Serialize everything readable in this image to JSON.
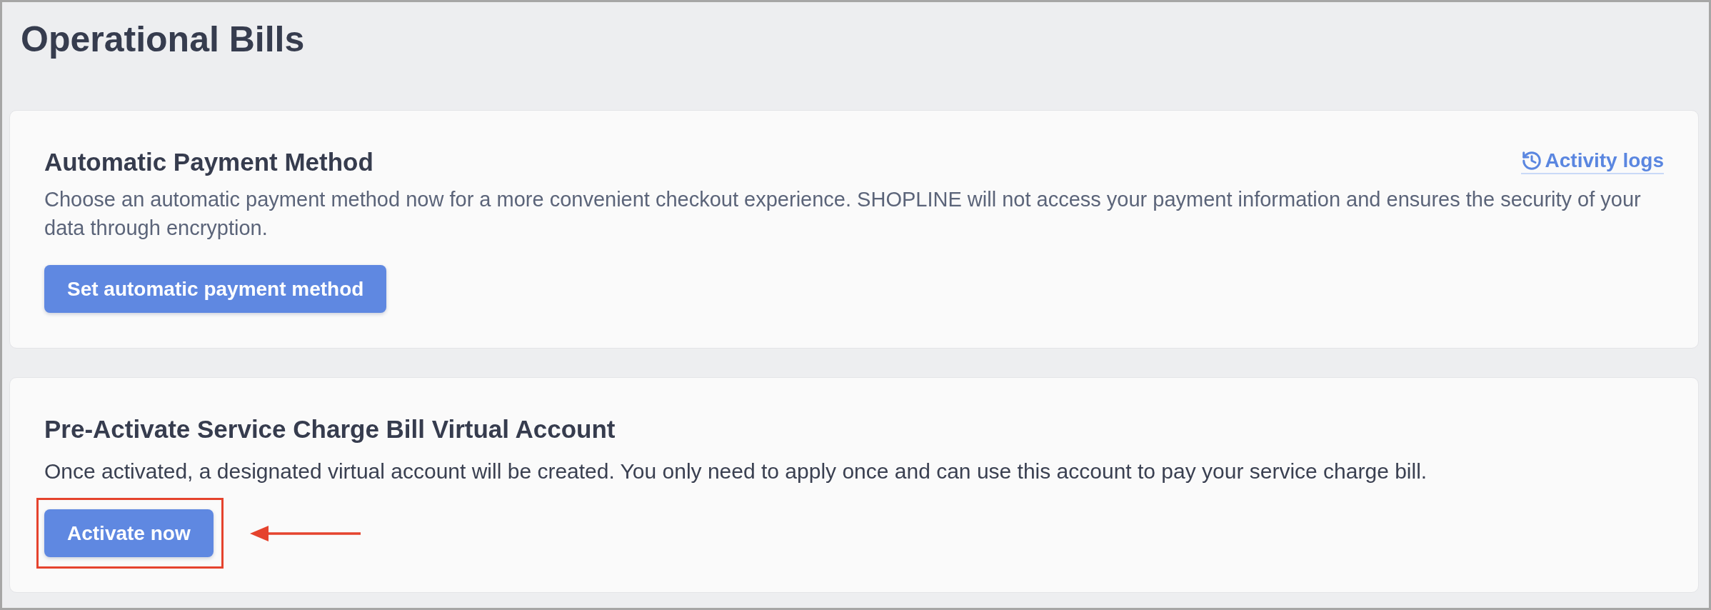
{
  "page": {
    "title": "Operational Bills"
  },
  "cards": [
    {
      "kind": "settings",
      "title": "Automatic Payment Method",
      "link": {
        "label": "Activity logs"
      },
      "description": "Choose an automatic payment method now for a more convenient checkout experience. SHOPLINE will not access your payment information and ensures the security of your data through encryption.",
      "button": {
        "label": "Set automatic payment method"
      }
    },
    {
      "kind": "activation",
      "title": "Pre-Activate Service Charge Bill Virtual Account",
      "description": "Once activated, a designated virtual account will be created. You only need to apply once and can use this account to pay your service charge bill.",
      "button": {
        "label": "Activate now",
        "highlighted": true
      }
    }
  ]
}
